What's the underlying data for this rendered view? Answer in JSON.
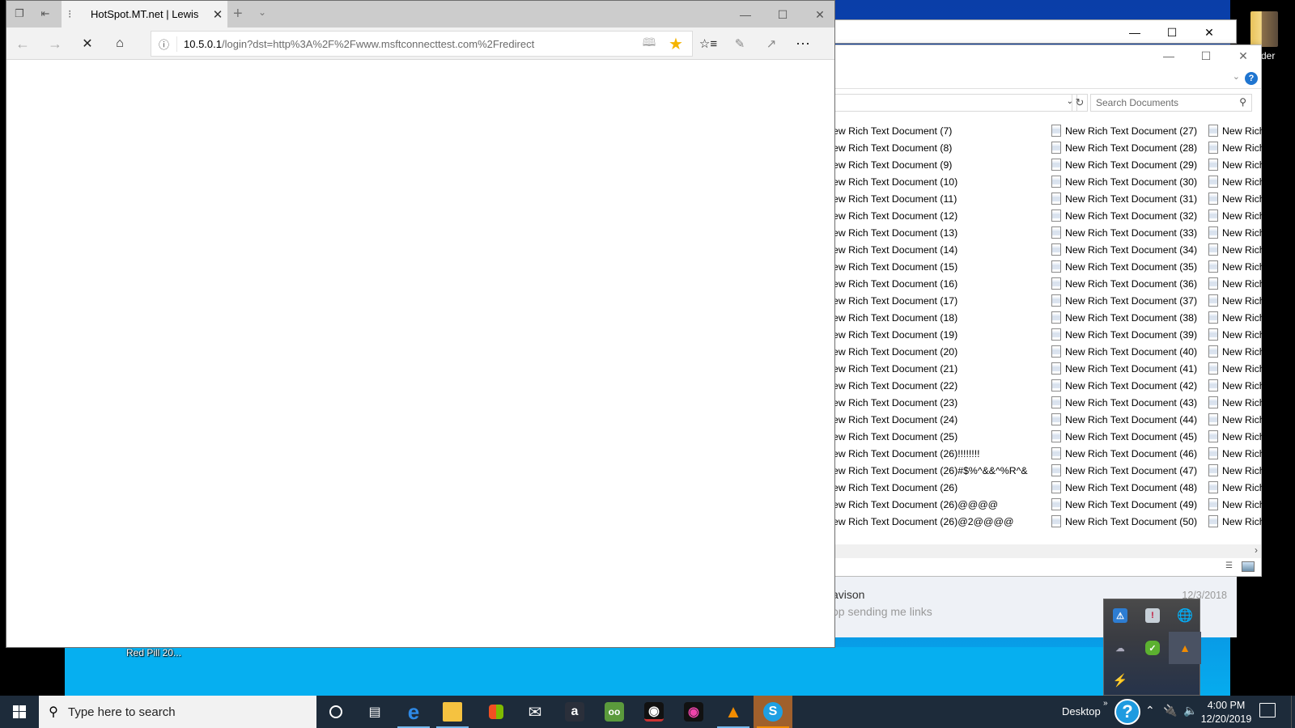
{
  "desktop": {
    "icons": [
      {
        "label": "older"
      },
      {
        "label": "Red Pill 20..."
      }
    ]
  },
  "browser": {
    "tab_title": "HotSpot.MT.net | Lewis",
    "url_host": "10.5.0.1",
    "url_path": "/login?dst=http%3A%2F%2Fwww.msftconnecttest.com%2Fredirect",
    "loading": true,
    "favorite_color": "#f5b400"
  },
  "explorer": {
    "search_placeholder": "Search Documents",
    "columns": [
      [
        "ew Rich Text Document (7)",
        "ew Rich Text Document (8)",
        "ew Rich Text Document (9)",
        "ew Rich Text Document (10)",
        "ew Rich Text Document (11)",
        "ew Rich Text Document (12)",
        "ew Rich Text Document (13)",
        "ew Rich Text Document (14)",
        "ew Rich Text Document (15)",
        "ew Rich Text Document (16)",
        "ew Rich Text Document (17)",
        "ew Rich Text Document (18)",
        "ew Rich Text Document (19)",
        "ew Rich Text Document (20)",
        "ew Rich Text Document (21)",
        "ew Rich Text Document (22)",
        "ew Rich Text Document (23)",
        "ew Rich Text Document (24)",
        "ew Rich Text Document (25)",
        "ew Rich Text Document (26)!!!!!!!!",
        "ew Rich Text Document (26)#$%^&&^%R^&",
        "ew Rich Text Document (26)",
        "ew Rich Text Document (26)@@@@",
        "ew Rich Text Document (26)@2@@@@"
      ],
      [
        "New Rich Text Document (27)",
        "New Rich Text Document (28)",
        "New Rich Text Document (29)",
        "New Rich Text Document (30)",
        "New Rich Text Document (31)",
        "New Rich Text Document (32)",
        "New Rich Text Document (33)",
        "New Rich Text Document (34)",
        "New Rich Text Document (35)",
        "New Rich Text Document (36)",
        "New Rich Text Document (37)",
        "New Rich Text Document (38)",
        "New Rich Text Document (39)",
        "New Rich Text Document (40)",
        "New Rich Text Document (41)",
        "New Rich Text Document (42)",
        "New Rich Text Document (43)",
        "New Rich Text Document (44)",
        "New Rich Text Document (45)",
        "New Rich Text Document (46)",
        "New Rich Text Document (47)",
        "New Rich Text Document (48)",
        "New Rich Text Document (49)",
        "New Rich Text Document (50)"
      ],
      [
        "New Rich",
        "New Rich",
        "New Rich",
        "New Rich",
        "New Rich",
        "New Rich",
        "New Rich",
        "New Rich",
        "New Rich",
        "New Rich",
        "New Rich",
        "New Rich",
        "New Rich",
        "New Rich",
        "New Rich",
        "New Rich",
        "New Rich",
        "New Rich",
        "New Rich",
        "New Rich",
        "New Rich",
        "New Rich",
        "New Rich",
        "New Rich"
      ]
    ]
  },
  "mail": {
    "from": "avison",
    "date": "12/3/2018",
    "preview": "op sending me links"
  },
  "taskbar": {
    "search_placeholder": "Type here to search",
    "desktop_label": "Desktop",
    "time": "4:00 PM",
    "date": "12/20/2019",
    "apps": [
      "cortana",
      "task-view",
      "edge",
      "file-explorer",
      "store",
      "mail",
      "amazon",
      "tripadvisor",
      "camera-app",
      "webcam-app",
      "vlc",
      "skype"
    ]
  },
  "tray_flyout": {
    "icons": [
      "network-warning",
      "security-alert",
      "globe-blocked",
      "cloud-offline",
      "check-status",
      "vlc",
      "power-tool"
    ]
  }
}
